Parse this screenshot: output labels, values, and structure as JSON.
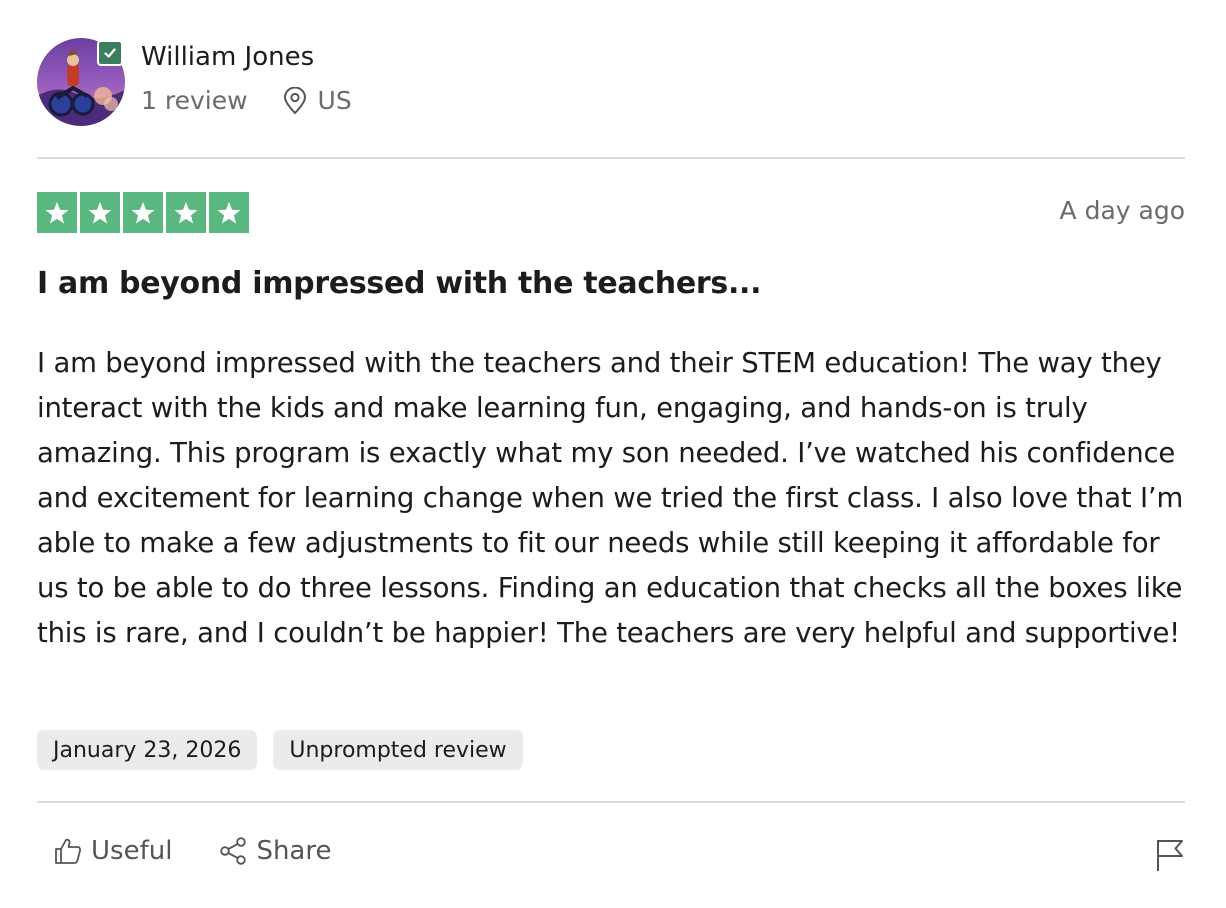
{
  "reviewer": {
    "name": "William Jones",
    "review_count": "1 review",
    "country": "US",
    "verified": true
  },
  "review": {
    "rating": 5,
    "rating_max": 5,
    "posted_ago": "A day ago",
    "title": "I am beyond impressed with the teachers...",
    "body": "I am beyond impressed with the teachers and their STEM education! The way they interact with the kids and make learning fun, engaging, and hands-on is truly amazing. This program is exactly what my son needed. I’ve watched his confidence and excitement for learning change when we tried the first class. I also love that I’m able to make a few adjustments to fit our needs while still keeping it affordable for us to be able to do three lessons. Finding an education that checks all the boxes like this is rare, and I couldn’t be happier! The teachers are very helpful and supportive!",
    "tags": {
      "date": "January 23, 2026",
      "type": "Unprompted review"
    }
  },
  "actions": {
    "useful_label": "Useful",
    "share_label": "Share",
    "useful_icon": "thumbs-up-icon",
    "share_icon": "share-icon",
    "report_icon": "flag-icon"
  },
  "colors": {
    "star_green": "#5ab77f",
    "verified_green": "#3c7f5e",
    "tag_bg": "#ebebeb"
  }
}
